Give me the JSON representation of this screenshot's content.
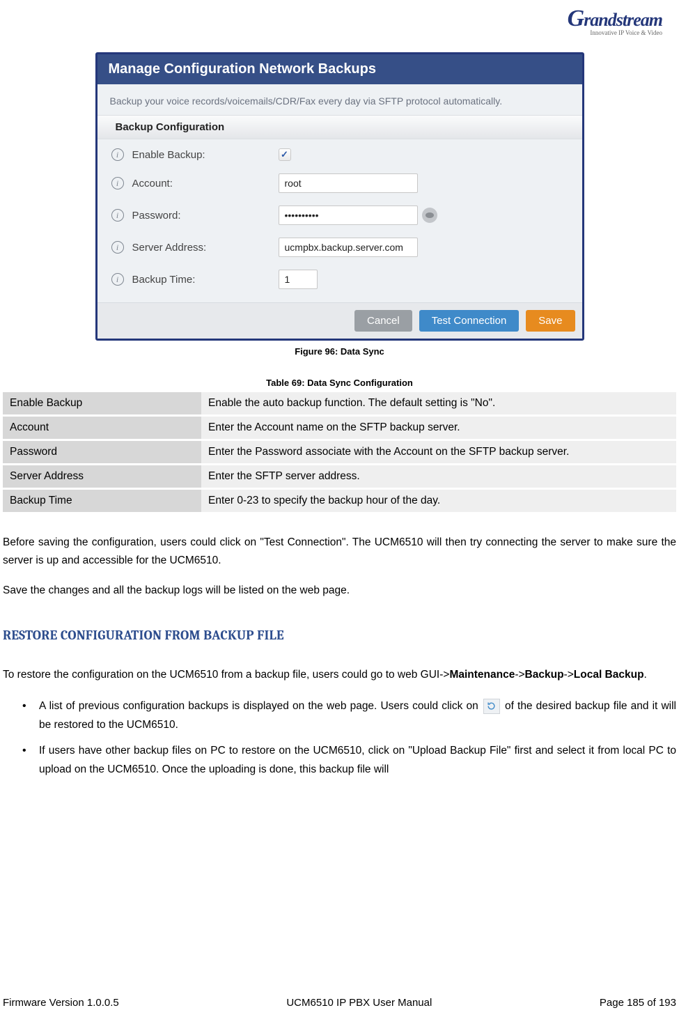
{
  "logo": {
    "brand": "Grandstream",
    "tagline": "Innovative IP Voice & Video"
  },
  "screenshot": {
    "title": "Manage Configuration Network Backups",
    "subtitle": "Backup your voice records/voicemails/CDR/Fax every day via SFTP protocol automatically.",
    "section_header": "Backup Configuration",
    "fields": {
      "enable_backup": {
        "label": "Enable Backup:",
        "checked": true
      },
      "account": {
        "label": "Account:",
        "value": "root"
      },
      "password": {
        "label": "Password:",
        "value": "••••••••••"
      },
      "server_address": {
        "label": "Server Address:",
        "value": "ucmpbx.backup.server.com"
      },
      "backup_time": {
        "label": "Backup Time:",
        "value": "1"
      }
    },
    "buttons": {
      "cancel": "Cancel",
      "test": "Test Connection",
      "save": "Save"
    }
  },
  "figure_caption": "Figure 96: Data Sync",
  "table_caption": "Table 69: Data Sync Configuration",
  "config_table": [
    {
      "name": "Enable Backup",
      "desc": "Enable the auto backup function. The default setting is \"No\"."
    },
    {
      "name": "Account",
      "desc": "Enter the Account name on the SFTP backup server."
    },
    {
      "name": "Password",
      "desc": "Enter the Password associate with the Account on the SFTP backup server."
    },
    {
      "name": "Server Address",
      "desc": "Enter the SFTP server address."
    },
    {
      "name": "Backup Time",
      "desc": "Enter 0-23 to specify the backup hour of the day."
    }
  ],
  "paragraphs": {
    "p1": "Before saving the configuration, users could click on \"Test Connection\". The UCM6510 will then try connecting the server to make sure the server is up and accessible for the UCM6510.",
    "p2": "Save the changes and all the backup logs will be listed on the web page."
  },
  "restore_heading": "RESTORE CONFIGURATION FROM BACKUP FILE",
  "restore_intro_pre": "To restore the configuration on the UCM6510 from a backup file, users could go to web GUI->",
  "restore_path": {
    "a": "Maintenance",
    "b": "Backup",
    "c": "Local Backup"
  },
  "bullets": {
    "b1_pre": "A list of previous configuration backups is displayed on the web page. Users could click on ",
    "b1_post": " of the desired backup file and it will be restored to the UCM6510.",
    "b2": "If users have other backup files on PC to restore on the UCM6510, click on \"Upload Backup File\" first and select it from local PC to upload on the UCM6510. Once the uploading is done, this backup file will"
  },
  "footer": {
    "left": "Firmware Version 1.0.0.5",
    "center": "UCM6510 IP PBX User Manual",
    "right": "Page 185 of 193"
  }
}
